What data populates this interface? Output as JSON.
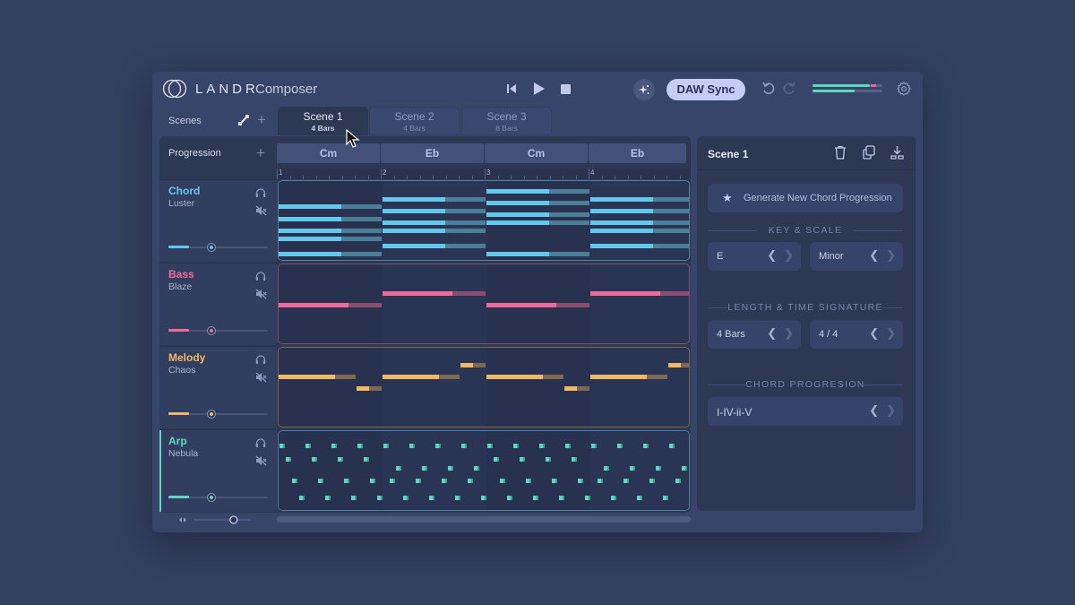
{
  "app": {
    "brand": "LANDR",
    "product": "Composer"
  },
  "header": {
    "daw_sync_label": "DAW Sync",
    "meter": {
      "left_level": 0.82,
      "left_peak": 0.9,
      "right_level": 0.6,
      "right_peak": 0.62
    }
  },
  "scenes": {
    "label": "Scenes",
    "tabs": [
      {
        "title": "Scene 1",
        "subtitle": "4 Bars",
        "active": true
      },
      {
        "title": "Scene 2",
        "subtitle": "4 Bars",
        "active": false
      },
      {
        "title": "Scene 3",
        "subtitle": "8 Bars",
        "active": false
      }
    ]
  },
  "progression": {
    "label": "Progression",
    "chords": [
      "Cm",
      "Eb",
      "Cm",
      "Eb"
    ],
    "bar_numbers": [
      "1",
      "2",
      "3",
      "4"
    ]
  },
  "tracks": [
    {
      "name": "Chord",
      "instrument": "Luster",
      "color": "#63c8ea",
      "volume": 0.5,
      "selected": false
    },
    {
      "name": "Bass",
      "instrument": "Blaze",
      "color": "#ef6b9b",
      "volume": 0.5,
      "selected": false
    },
    {
      "name": "Melody",
      "instrument": "Chaos",
      "color": "#f0b964",
      "volume": 0.5,
      "selected": false
    },
    {
      "name": "Arp",
      "instrument": "Nebula",
      "color": "#5fd7c0",
      "volume": 0.5,
      "selected": true
    }
  ],
  "patterns": {
    "chord": [
      [
        [
          0,
          0.6,
          1,
          6
        ],
        [
          0,
          0.6,
          1,
          9
        ],
        [
          0,
          0.6,
          1,
          12
        ],
        [
          0,
          0.6,
          1,
          14
        ],
        [
          0,
          0.6,
          1,
          18
        ]
      ],
      [
        [
          1,
          1.6,
          2,
          4
        ],
        [
          1,
          1.6,
          2,
          7
        ],
        [
          1,
          1.6,
          2,
          10
        ],
        [
          1,
          1.6,
          2,
          12
        ],
        [
          1,
          1.6,
          2,
          16
        ]
      ],
      [
        [
          2,
          2.6,
          3,
          2
        ],
        [
          2,
          2.6,
          3,
          5
        ],
        [
          2,
          2.6,
          3,
          8
        ],
        [
          2,
          2.6,
          3,
          10
        ],
        [
          2,
          2.6,
          3,
          18
        ]
      ],
      [
        [
          3,
          3.6,
          4,
          4
        ],
        [
          3,
          3.6,
          4,
          7
        ],
        [
          3,
          3.6,
          4,
          10
        ],
        [
          3,
          3.6,
          4,
          12
        ],
        [
          3,
          3.6,
          4,
          16
        ]
      ]
    ],
    "bass": [
      [
        0,
        0.67,
        1,
        10
      ],
      [
        1,
        1.67,
        2,
        7
      ],
      [
        2,
        2.67,
        3,
        10
      ],
      [
        3,
        3.67,
        4,
        7
      ]
    ],
    "melody": [
      [
        0,
        0.54,
        0.75,
        7
      ],
      [
        0.75,
        0.87,
        1,
        10
      ],
      [
        1,
        1.54,
        1.75,
        7
      ],
      [
        1.75,
        1.87,
        2,
        4
      ],
      [
        2,
        2.54,
        2.75,
        7
      ],
      [
        2.75,
        2.87,
        3,
        10
      ],
      [
        3,
        3.54,
        3.75,
        7
      ],
      [
        3.75,
        3.87,
        4,
        4
      ]
    ],
    "arp_rows": [
      [
        0,
        0.25,
        0.5,
        0.75,
        1,
        1.25,
        1.5,
        1.75,
        2,
        2.25,
        2.5,
        2.75,
        3,
        3.25,
        3.5,
        3.75
      ],
      [
        0.06,
        0.31,
        0.56,
        0.81,
        2.06,
        2.31,
        2.56,
        2.81
      ],
      [
        1.12,
        1.37,
        1.62,
        1.87,
        3.12,
        3.37,
        3.62,
        3.87
      ],
      [
        0.12,
        0.37,
        0.62,
        0.87,
        1.06,
        1.31,
        1.56,
        1.81,
        2.12,
        2.37,
        2.62,
        2.87,
        3.06,
        3.31,
        3.56,
        3.81
      ],
      [
        0.19,
        0.44,
        0.69,
        0.94,
        1.19,
        1.44,
        1.69,
        1.94,
        2.19,
        2.44,
        2.69,
        2.94,
        3.19,
        3.44,
        3.69,
        3.94
      ]
    ]
  },
  "footer": {
    "zoom": 0.7,
    "scroll_fraction": 1.0
  },
  "side": {
    "title": "Scene 1",
    "generate_label": "Generate New Chord Progression",
    "key_scale_title": "KEY & SCALE",
    "key_value": "E",
    "scale_value": "Minor",
    "length_title": "LENGTH & TIME SIGNATURE",
    "length_value": "4 Bars",
    "time_sig_value": "4 / 4",
    "progression_title": "CHORD PROGRESION",
    "progression_value": "I-IV-ii-V"
  },
  "icons": {
    "prev": "skip-back-icon",
    "play": "play-icon",
    "stop": "stop-icon",
    "ai": "sparkle-icon",
    "undo": "undo-icon",
    "redo": "redo-icon",
    "settings": "gear-icon",
    "headphones": "headphones-icon",
    "mute": "speaker-mute-icon",
    "trash": "trash-icon",
    "duplicate": "copy-icon",
    "export": "download-icon"
  }
}
